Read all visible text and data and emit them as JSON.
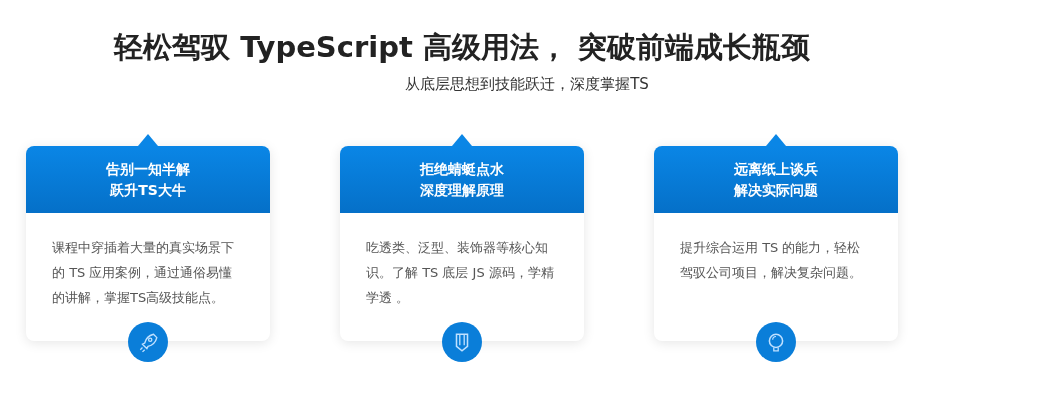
{
  "heading": "轻松驾驭 TypeScript 高级用法， 突破前端成长瓶颈",
  "subheading": "从底层思想到技能跃迁，深度掌握TS",
  "cards": [
    {
      "title_lines": [
        "告别一知半解",
        "跃升TS大牛"
      ],
      "text": "课程中穿插着大量的真实场景下的 TS 应用案例，通过通俗易懂的讲解，掌握TS高级技能点。"
    },
    {
      "title_lines": [
        "拒绝蜻蜓点水",
        "深度理解原理"
      ],
      "text": "吃透类、泛型、装饰器等核心知识。了解 TS 底层 JS 源码，学精学透 。"
    },
    {
      "title_lines": [
        "远离纸上谈兵",
        "解决实际问题"
      ],
      "text": "提升综合运用 TS 的能力，轻松驾驭公司项目，解决复杂问题。"
    }
  ]
}
